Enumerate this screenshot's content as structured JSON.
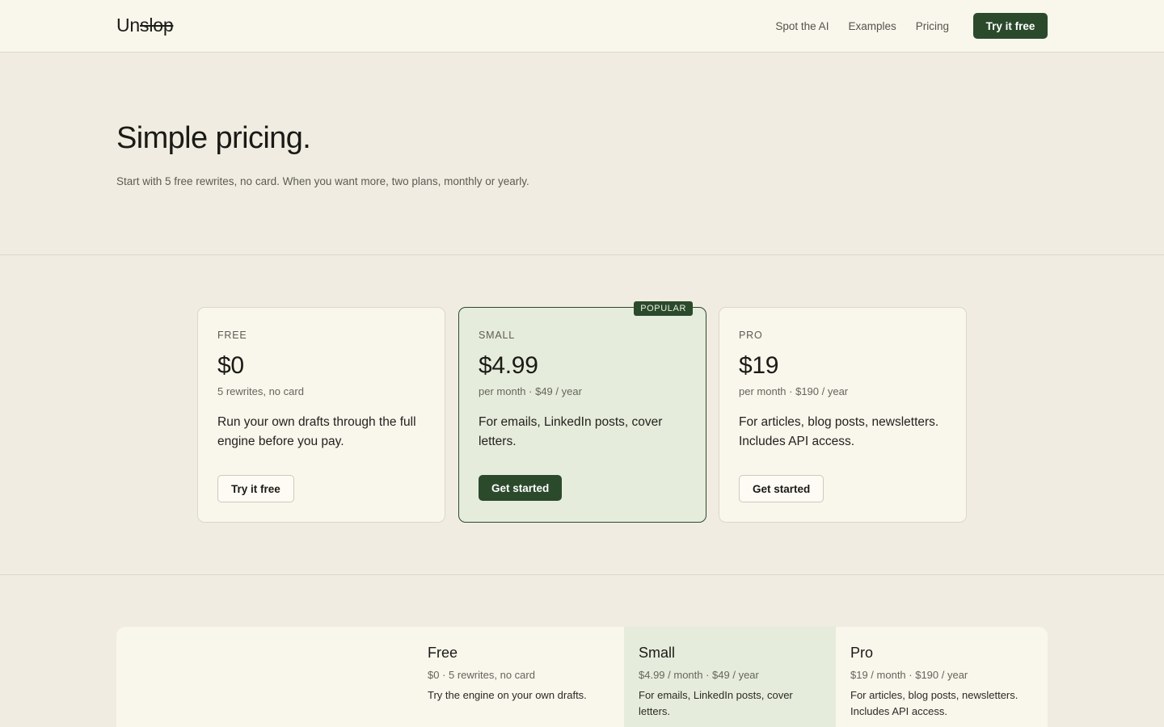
{
  "brand": {
    "prefix": "Un",
    "struck": "slop"
  },
  "nav": {
    "links": [
      "Spot the AI",
      "Examples",
      "Pricing"
    ],
    "cta": "Try it free"
  },
  "hero": {
    "title": "Simple pricing.",
    "subtitle": "Start with 5 free rewrites, no card. When you want more, two plans, monthly or yearly."
  },
  "plans": [
    {
      "tier": "FREE",
      "price": "$0",
      "sub": "5 rewrites, no card",
      "desc": "Run your own drafts through the full engine before you pay.",
      "cta": "Try it free"
    },
    {
      "tier": "SMALL",
      "badge": "POPULAR",
      "price": "$4.99",
      "sub": "per month · $49 / year",
      "desc": "For emails, LinkedIn posts, cover letters.",
      "cta": "Get started"
    },
    {
      "tier": "PRO",
      "price": "$19",
      "sub": "per month · $190 / year",
      "desc": "For articles, blog posts, newsletters. Includes API access.",
      "cta": "Get started"
    }
  ],
  "compare": [
    {
      "name": "Free",
      "meta": "$0 · 5 rewrites, no card",
      "note": "Try the engine on your own drafts."
    },
    {
      "name": "Small",
      "meta": "$4.99 / month · $49 / year",
      "note": "For emails, LinkedIn posts, cover letters."
    },
    {
      "name": "Pro",
      "meta": "$19 / month · $190 / year",
      "note": "For articles, blog posts, newsletters. Includes API access."
    }
  ],
  "colors": {
    "accent": "#2b4a2c",
    "page_bg": "#f0ece1",
    "card_bg": "#f9f6ec",
    "featured_bg": "#e6ecdc"
  }
}
